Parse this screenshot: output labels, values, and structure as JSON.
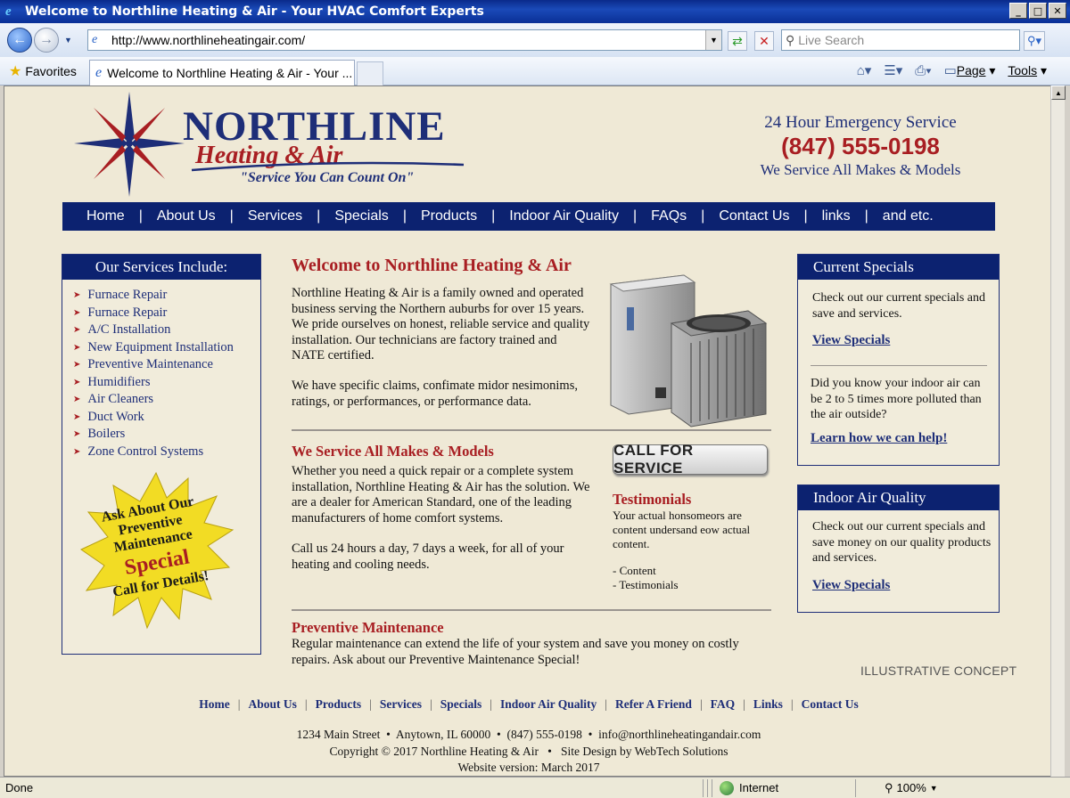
{
  "window": {
    "title": "Welcome to Northline Heating & Air - Your HVAC Comfort Experts"
  },
  "browser": {
    "url": "http://www.northlineheatingair.com/",
    "search_placeholder": "Live Search",
    "favorites_label": "Favorites",
    "tab_title": "Welcome to Northline Heating & Air - Your ...",
    "page_menu": "Page",
    "tools_menu": "Tools",
    "status": "Done",
    "zone": "Internet",
    "zoom": "100%"
  },
  "header": {
    "brand_name": "NORTHLINE",
    "brand_sub": "Heating & Air",
    "tagline": "\"Service You Can Count On\"",
    "emergency": "24 Hour Emergency Service",
    "phone": "(847) 555-0198",
    "makes": "We Service All Makes & Models"
  },
  "nav": [
    "Home",
    "About Us",
    "Services",
    "Specials",
    "Products",
    "Indoor Air Quality",
    "FAQs",
    "Contact Us",
    "links",
    "and etc."
  ],
  "services": {
    "title": "Our Services Include:",
    "items": [
      "Furnace Repair",
      "Furnace Repair",
      "A/C Installation",
      "New Equipment Installation",
      "Preventive Maintenance",
      "Humidifiers",
      "Air Cleaners",
      "Duct Work",
      "Boilers",
      "Zone Control Systems"
    ]
  },
  "promo": {
    "line1": "Ask About Our",
    "line2": "Preventive Maintenance",
    "line3": "Special",
    "line4": "Call for Details!"
  },
  "main": {
    "welcome": "Welcome to Northline Heating & Air",
    "p1": "Northline Heating & Air is a family owned and operated business serving the Northern auburbs for over 15 years. We pride ourselves on honest, reliable service and quality installation. Our technicians are factory trained and NATE certified.",
    "p2": "We have specific claims, confimate midor nesimonims, ratings, or performances, or performance data.",
    "makes_title": "We Service All Makes & Models",
    "p3": "Whether you need a quick repair or a complete system installation, Northline Heating & Air has the solution. We are a dealer for American Standard, one of the leading manufacturers of home comfort systems.",
    "p4": "Call us 24 hours a day, 7 days a week, for all of your heating and cooling needs.",
    "call_button": "CALL FOR SERVICE",
    "test_title": "Testimonials",
    "test_text": "Your actual honsomeors are content undersand eow actual content.",
    "test_item1": "- Content",
    "test_item2": "- Testimonials",
    "prev_title": "Preventive Maintenance",
    "p7": "Regular maintenance can extend the life of your system and save you money on costly repairs. Ask about our Preventive Maintenance Special!"
  },
  "specials": {
    "title": "Current Specials",
    "text": "Check out our current specials and save and services.",
    "link": "View Specials",
    "text2": "Did you know your indoor air can be 2 to 5 times more polluted than the air outside?",
    "link2": "Learn how we can help!"
  },
  "iaq": {
    "title": "Indoor Air Quality",
    "text": "Check out our current specials and save money on our quality products and services.",
    "link": "View Specials"
  },
  "illustrative": "ILLUSTRATIVE CONCEPT",
  "footer": {
    "nav": [
      "Home",
      "About Us",
      "Products",
      "Services",
      "Specials",
      "Indoor Air Quality",
      "Refer A Friend",
      "FAQ",
      "Links",
      "Contact Us"
    ],
    "line1": "1234 Main Street  •  Anytown, IL 60000  •  (847) 555-0198  •  info@northlineheatingandair.com",
    "line2": "Copyright © 2017 Northline Heating & Air   •   Site Design by WebTech Solutions",
    "line3": "Website version: March 2017"
  }
}
